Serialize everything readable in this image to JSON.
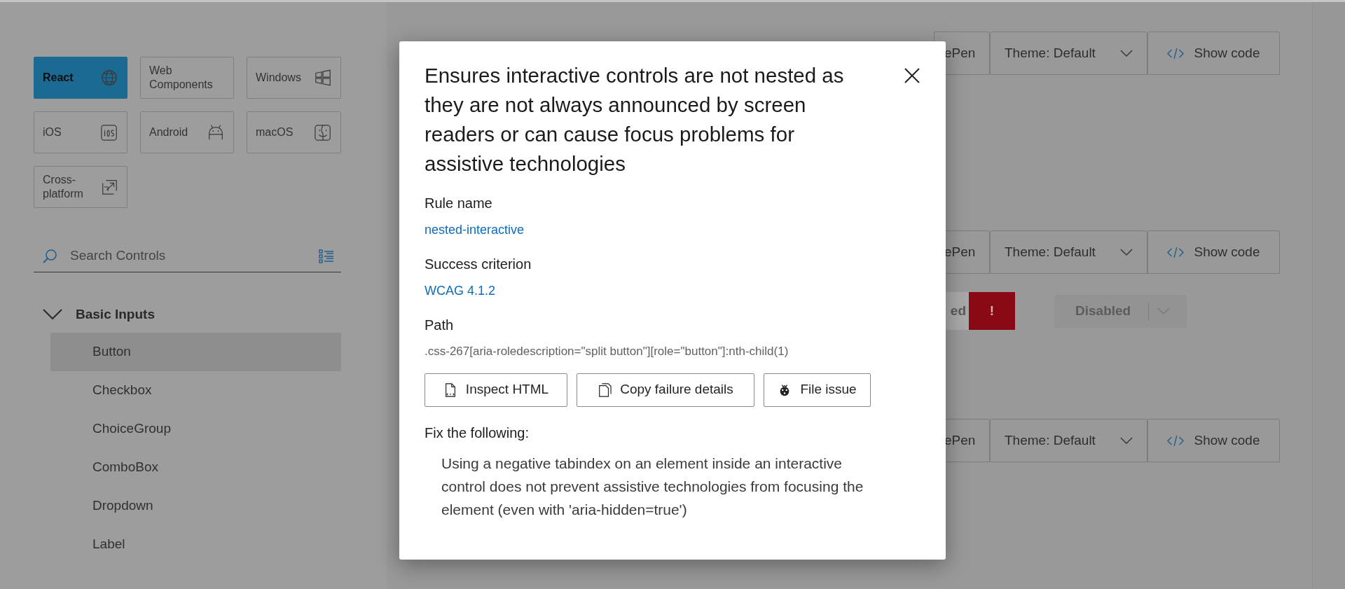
{
  "platforms": [
    {
      "label": "React",
      "selected": true
    },
    {
      "label": "Web Components",
      "selected": false
    },
    {
      "label": "Windows",
      "selected": false
    },
    {
      "label": "iOS",
      "selected": false
    },
    {
      "label": "Android",
      "selected": false
    },
    {
      "label": "macOS",
      "selected": false
    },
    {
      "label": "Cross-platform",
      "selected": false
    }
  ],
  "search": {
    "placeholder": "Search Controls"
  },
  "nav": {
    "group": "Basic Inputs",
    "expanded": true,
    "items": [
      {
        "label": "Button",
        "selected": true
      },
      {
        "label": "Checkbox",
        "selected": false
      },
      {
        "label": "ChoiceGroup",
        "selected": false
      },
      {
        "label": "ComboBox",
        "selected": false
      },
      {
        "label": "Dropdown",
        "selected": false
      },
      {
        "label": "Label",
        "selected": false
      }
    ]
  },
  "toolbars": [
    {
      "codepen": "ePen",
      "theme": "Theme: Default",
      "show_code": "Show code"
    },
    {
      "codepen": "ePen",
      "theme": "Theme: Default",
      "show_code": "Show code"
    },
    {
      "codepen": "ePen",
      "theme": "Theme: Default",
      "show_code": "Show code"
    }
  ],
  "split_buttons": [
    {
      "label": "ed",
      "action": "!",
      "disabled": false
    },
    {
      "label": "Disabled",
      "disabled": true
    }
  ],
  "dialog": {
    "title": "Ensures interactive controls are not nested as they are not always announced by screen readers or can cause focus problems for assistive technologies",
    "rule_label": "Rule name",
    "rule": "nested-interactive",
    "criterion_label": "Success criterion",
    "criterion": "WCAG 4.1.2",
    "path_label": "Path",
    "path": ".css-267[aria-roledescription=\"split button\"][role=\"button\"]:nth-child(1)",
    "actions": [
      "Inspect HTML",
      "Copy failure details",
      "File issue"
    ],
    "fix_label": "Fix the following:",
    "fix": "Using a negative tabindex on an element inside an interactive control does not prevent assistive technologies from focusing the element (even with 'aria-hidden=true')"
  }
}
